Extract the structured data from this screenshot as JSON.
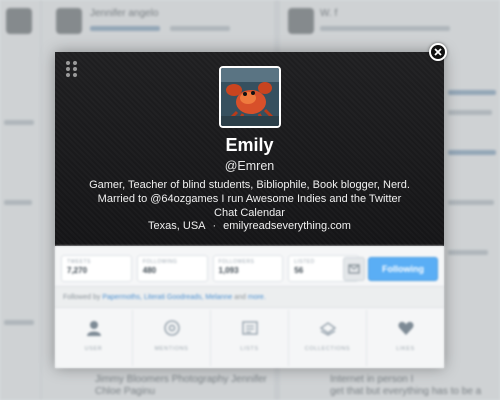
{
  "background": {
    "top_name": "Jennifer angelo",
    "right_name": "W. f",
    "bottom_left": "Jimmy Bloomers Photography Jennifer",
    "bottom_left_2": "Chloe Paginu",
    "bottom_right": "Internet in person I",
    "bottom_right_2": "get that but everything has to be a"
  },
  "profile": {
    "name": "Emily",
    "handle": "@Emren",
    "bio": "Gamer, Teacher of blind students, Bibliophile, Book blogger, Nerd. Married to @64ozgames I run Awesome Indies and the Twitter Chat Calendar",
    "location": "Texas, USA",
    "separator": "·",
    "website": "emilyreadseverything.com"
  },
  "stats": [
    {
      "label": "TWEETS",
      "value": "7,270"
    },
    {
      "label": "FOLLOWING",
      "value": "480"
    },
    {
      "label": "FOLLOWERS",
      "value": "1,093"
    },
    {
      "label": "LISTED",
      "value": "56"
    }
  ],
  "follow_button": "Following",
  "followed_by": {
    "prefix": "Followed by",
    "names": "Papermoths, Literati Goodreads, Melanne",
    "suffix": "and",
    "more": "more."
  },
  "tabs": [
    {
      "label": "USER",
      "icon": "user-icon"
    },
    {
      "label": "MENTIONS",
      "icon": "at-icon"
    },
    {
      "label": "LISTS",
      "icon": "list-icon"
    },
    {
      "label": "COLLECTIONS",
      "icon": "collections-icon"
    },
    {
      "label": "LIKES",
      "icon": "heart-icon"
    }
  ],
  "colors": {
    "header": "#1a1a1c",
    "follow_button": "#5aaef5",
    "link": "#4a8fd0"
  }
}
